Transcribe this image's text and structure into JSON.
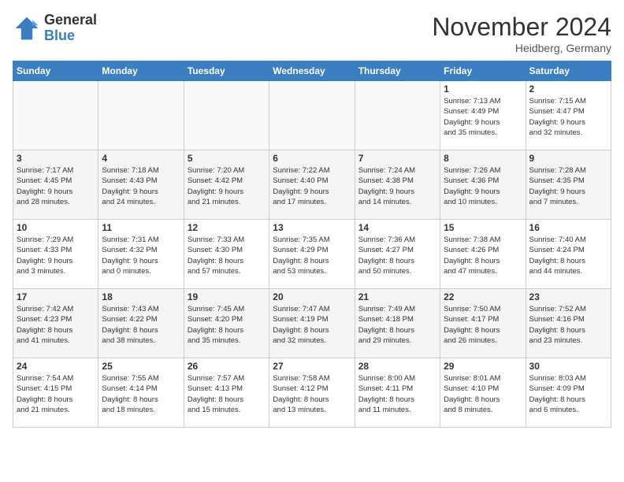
{
  "header": {
    "logo_general": "General",
    "logo_blue": "Blue",
    "month_title": "November 2024",
    "location": "Heidberg, Germany"
  },
  "days_of_week": [
    "Sunday",
    "Monday",
    "Tuesday",
    "Wednesday",
    "Thursday",
    "Friday",
    "Saturday"
  ],
  "weeks": [
    [
      {
        "day": "",
        "info": ""
      },
      {
        "day": "",
        "info": ""
      },
      {
        "day": "",
        "info": ""
      },
      {
        "day": "",
        "info": ""
      },
      {
        "day": "",
        "info": ""
      },
      {
        "day": "1",
        "info": "Sunrise: 7:13 AM\nSunset: 4:49 PM\nDaylight: 9 hours\nand 35 minutes."
      },
      {
        "day": "2",
        "info": "Sunrise: 7:15 AM\nSunset: 4:47 PM\nDaylight: 9 hours\nand 32 minutes."
      }
    ],
    [
      {
        "day": "3",
        "info": "Sunrise: 7:17 AM\nSunset: 4:45 PM\nDaylight: 9 hours\nand 28 minutes."
      },
      {
        "day": "4",
        "info": "Sunrise: 7:18 AM\nSunset: 4:43 PM\nDaylight: 9 hours\nand 24 minutes."
      },
      {
        "day": "5",
        "info": "Sunrise: 7:20 AM\nSunset: 4:42 PM\nDaylight: 9 hours\nand 21 minutes."
      },
      {
        "day": "6",
        "info": "Sunrise: 7:22 AM\nSunset: 4:40 PM\nDaylight: 9 hours\nand 17 minutes."
      },
      {
        "day": "7",
        "info": "Sunrise: 7:24 AM\nSunset: 4:38 PM\nDaylight: 9 hours\nand 14 minutes."
      },
      {
        "day": "8",
        "info": "Sunrise: 7:26 AM\nSunset: 4:36 PM\nDaylight: 9 hours\nand 10 minutes."
      },
      {
        "day": "9",
        "info": "Sunrise: 7:28 AM\nSunset: 4:35 PM\nDaylight: 9 hours\nand 7 minutes."
      }
    ],
    [
      {
        "day": "10",
        "info": "Sunrise: 7:29 AM\nSunset: 4:33 PM\nDaylight: 9 hours\nand 3 minutes."
      },
      {
        "day": "11",
        "info": "Sunrise: 7:31 AM\nSunset: 4:32 PM\nDaylight: 9 hours\nand 0 minutes."
      },
      {
        "day": "12",
        "info": "Sunrise: 7:33 AM\nSunset: 4:30 PM\nDaylight: 8 hours\nand 57 minutes."
      },
      {
        "day": "13",
        "info": "Sunrise: 7:35 AM\nSunset: 4:29 PM\nDaylight: 8 hours\nand 53 minutes."
      },
      {
        "day": "14",
        "info": "Sunrise: 7:36 AM\nSunset: 4:27 PM\nDaylight: 8 hours\nand 50 minutes."
      },
      {
        "day": "15",
        "info": "Sunrise: 7:38 AM\nSunset: 4:26 PM\nDaylight: 8 hours\nand 47 minutes."
      },
      {
        "day": "16",
        "info": "Sunrise: 7:40 AM\nSunset: 4:24 PM\nDaylight: 8 hours\nand 44 minutes."
      }
    ],
    [
      {
        "day": "17",
        "info": "Sunrise: 7:42 AM\nSunset: 4:23 PM\nDaylight: 8 hours\nand 41 minutes."
      },
      {
        "day": "18",
        "info": "Sunrise: 7:43 AM\nSunset: 4:22 PM\nDaylight: 8 hours\nand 38 minutes."
      },
      {
        "day": "19",
        "info": "Sunrise: 7:45 AM\nSunset: 4:20 PM\nDaylight: 8 hours\nand 35 minutes."
      },
      {
        "day": "20",
        "info": "Sunrise: 7:47 AM\nSunset: 4:19 PM\nDaylight: 8 hours\nand 32 minutes."
      },
      {
        "day": "21",
        "info": "Sunrise: 7:49 AM\nSunset: 4:18 PM\nDaylight: 8 hours\nand 29 minutes."
      },
      {
        "day": "22",
        "info": "Sunrise: 7:50 AM\nSunset: 4:17 PM\nDaylight: 8 hours\nand 26 minutes."
      },
      {
        "day": "23",
        "info": "Sunrise: 7:52 AM\nSunset: 4:16 PM\nDaylight: 8 hours\nand 23 minutes."
      }
    ],
    [
      {
        "day": "24",
        "info": "Sunrise: 7:54 AM\nSunset: 4:15 PM\nDaylight: 8 hours\nand 21 minutes."
      },
      {
        "day": "25",
        "info": "Sunrise: 7:55 AM\nSunset: 4:14 PM\nDaylight: 8 hours\nand 18 minutes."
      },
      {
        "day": "26",
        "info": "Sunrise: 7:57 AM\nSunset: 4:13 PM\nDaylight: 8 hours\nand 15 minutes."
      },
      {
        "day": "27",
        "info": "Sunrise: 7:58 AM\nSunset: 4:12 PM\nDaylight: 8 hours\nand 13 minutes."
      },
      {
        "day": "28",
        "info": "Sunrise: 8:00 AM\nSunset: 4:11 PM\nDaylight: 8 hours\nand 11 minutes."
      },
      {
        "day": "29",
        "info": "Sunrise: 8:01 AM\nSunset: 4:10 PM\nDaylight: 8 hours\nand 8 minutes."
      },
      {
        "day": "30",
        "info": "Sunrise: 8:03 AM\nSunset: 4:09 PM\nDaylight: 8 hours\nand 6 minutes."
      }
    ]
  ]
}
